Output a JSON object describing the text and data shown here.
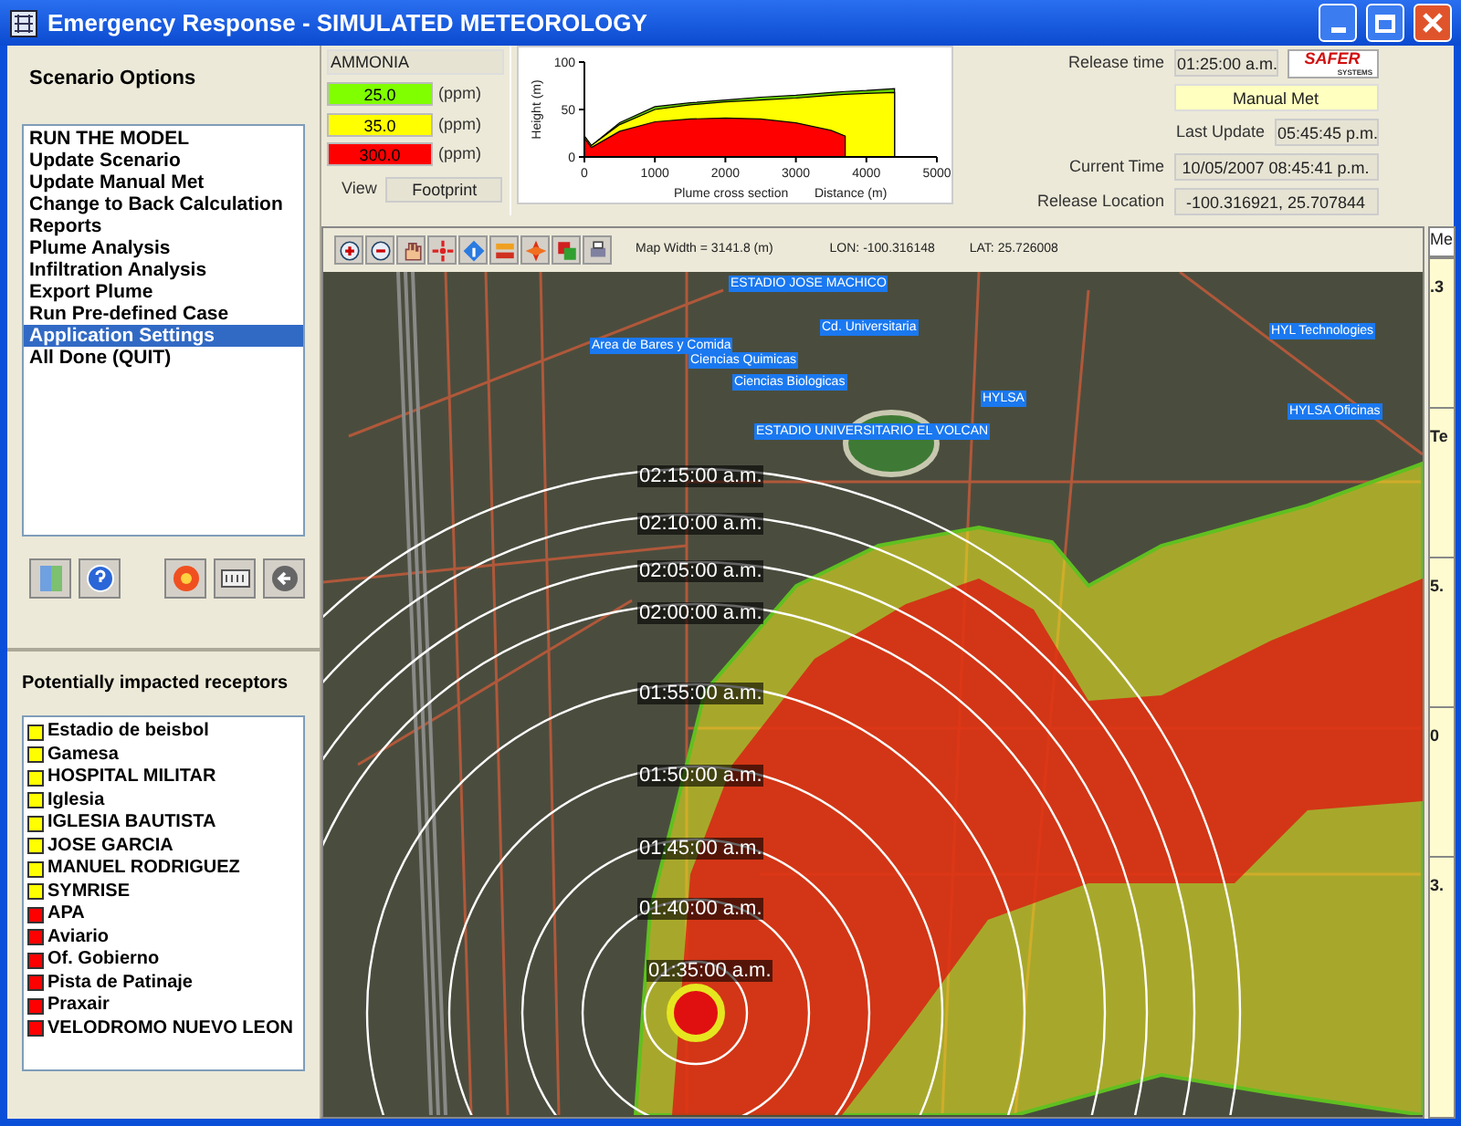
{
  "window": {
    "title": "Emergency Response - SIMULATED METEOROLOGY"
  },
  "scenario_options": {
    "title": "Scenario Options",
    "items": [
      {
        "label": "RUN THE MODEL",
        "selected": false
      },
      {
        "label": "Update Scenario",
        "selected": false
      },
      {
        "label": "Update Manual Met",
        "selected": false
      },
      {
        "label": "Change to Back Calculation",
        "selected": false
      },
      {
        "label": "Reports",
        "selected": false
      },
      {
        "label": "Plume Analysis",
        "selected": false
      },
      {
        "label": "Infiltration Analysis",
        "selected": false
      },
      {
        "label": "Export Plume",
        "selected": false
      },
      {
        "label": "Run Pre-defined Case",
        "selected": false
      },
      {
        "label": "Application Settings",
        "selected": true
      },
      {
        "label": "All Done (QUIT)",
        "selected": false
      }
    ]
  },
  "receptors": {
    "title": "Potentially impacted receptors",
    "items": [
      {
        "label": "Estadio de beisbol",
        "color": "#ffff00"
      },
      {
        "label": "Gamesa",
        "color": "#ffff00"
      },
      {
        "label": "HOSPITAL MILITAR",
        "color": "#ffff00"
      },
      {
        "label": "Iglesia",
        "color": "#ffff00"
      },
      {
        "label": "IGLESIA BAUTISTA",
        "color": "#ffff00"
      },
      {
        "label": "JOSE GARCIA",
        "color": "#ffff00"
      },
      {
        "label": "MANUEL RODRIGUEZ",
        "color": "#ffff00"
      },
      {
        "label": "SYMRISE",
        "color": "#ffff00"
      },
      {
        "label": "APA",
        "color": "#ff0000"
      },
      {
        "label": "Aviario",
        "color": "#ff0000"
      },
      {
        "label": "Of. Gobierno",
        "color": "#ff0000"
      },
      {
        "label": "Pista de Patinaje",
        "color": "#ff0000"
      },
      {
        "label": "Praxair",
        "color": "#ff0000"
      },
      {
        "label": "VELODROMO NUEVO LEON",
        "color": "#ff0000"
      }
    ]
  },
  "chemical": {
    "name": "AMMONIA",
    "levels": [
      {
        "value": "25.0",
        "unit": "(ppm)",
        "color": "#80ff00"
      },
      {
        "value": "35.0",
        "unit": "(ppm)",
        "color": "#ffff00"
      },
      {
        "value": "300.0",
        "unit": "(ppm)",
        "color": "#ff0000"
      }
    ],
    "view_label": "View",
    "view_value": "Footprint"
  },
  "profile": {
    "chart_data": {
      "type": "area",
      "xlabel": "Distance (m)",
      "ylabel": "Height (m)",
      "x": [
        0,
        100,
        500,
        1000,
        1500,
        2000,
        2500,
        3000,
        3500,
        3700,
        4000,
        4400
      ],
      "series": [
        {
          "color": "#66cc00",
          "values": [
            22,
            12,
            36,
            53,
            57,
            60,
            63,
            65,
            68,
            69,
            70,
            72
          ]
        },
        {
          "color": "#ffff00",
          "values": [
            22,
            12,
            34,
            50,
            55,
            58,
            60,
            62,
            65,
            66,
            67,
            68
          ]
        },
        {
          "color": "#ff0000",
          "values": [
            20,
            10,
            27,
            37,
            40,
            41,
            40,
            36,
            28,
            22,
            null,
            null
          ]
        }
      ],
      "xlim": [
        0,
        5000
      ],
      "ylim": [
        0,
        100
      ],
      "xticks": [
        0,
        1000,
        2000,
        3000,
        4000,
        5000
      ],
      "yticks": [
        0,
        50,
        100
      ]
    },
    "caption": "Plume cross section"
  },
  "info": {
    "fields": [
      {
        "label": "Release time",
        "value": "01:25:00 a.m.",
        "kind": "plain"
      },
      {
        "value": "Manual Met",
        "kind": "highlight"
      },
      {
        "label": "Last Update",
        "value": "05:45:45 p.m.",
        "kind": "plain"
      },
      {
        "label": "Current Time",
        "value": "10/05/2007  08:45:41 p.m.",
        "kind": "plain"
      },
      {
        "label": "Release Location",
        "value": "-100.316921, 25.707844",
        "kind": "plain"
      }
    ],
    "logo": {
      "name": "SAFER",
      "sub": "SYSTEMS"
    }
  },
  "map": {
    "map_width": "Map Width = 3141.8 (m)",
    "lon": "LON: -100.316148",
    "lat": "LAT: 25.726008",
    "places": [
      "ESTADIO JOSE MACHICO",
      "Cd. Universitaria",
      "Area de Bares y Comida",
      "Ciencias Quimicas",
      "Ciencias Biologicas",
      "HYLSA",
      "HYL Technologies",
      "HYLSA Oficinas",
      "ESTADIO UNIVERSITARIO EL VOLCAN"
    ],
    "time_rings": [
      "02:15:00 a.m.",
      "02:10:00 a.m.",
      "02:05:00 a.m.",
      "02:00:00 a.m.",
      "01:55:00 a.m.",
      "01:50:00 a.m.",
      "01:45:00 a.m.",
      "01:40:00 a.m.",
      "01:35:00 a.m."
    ]
  },
  "side_panel": {
    "header": "Me",
    "cells": [
      ".3",
      "Te",
      "5.",
      "0",
      "3."
    ]
  }
}
